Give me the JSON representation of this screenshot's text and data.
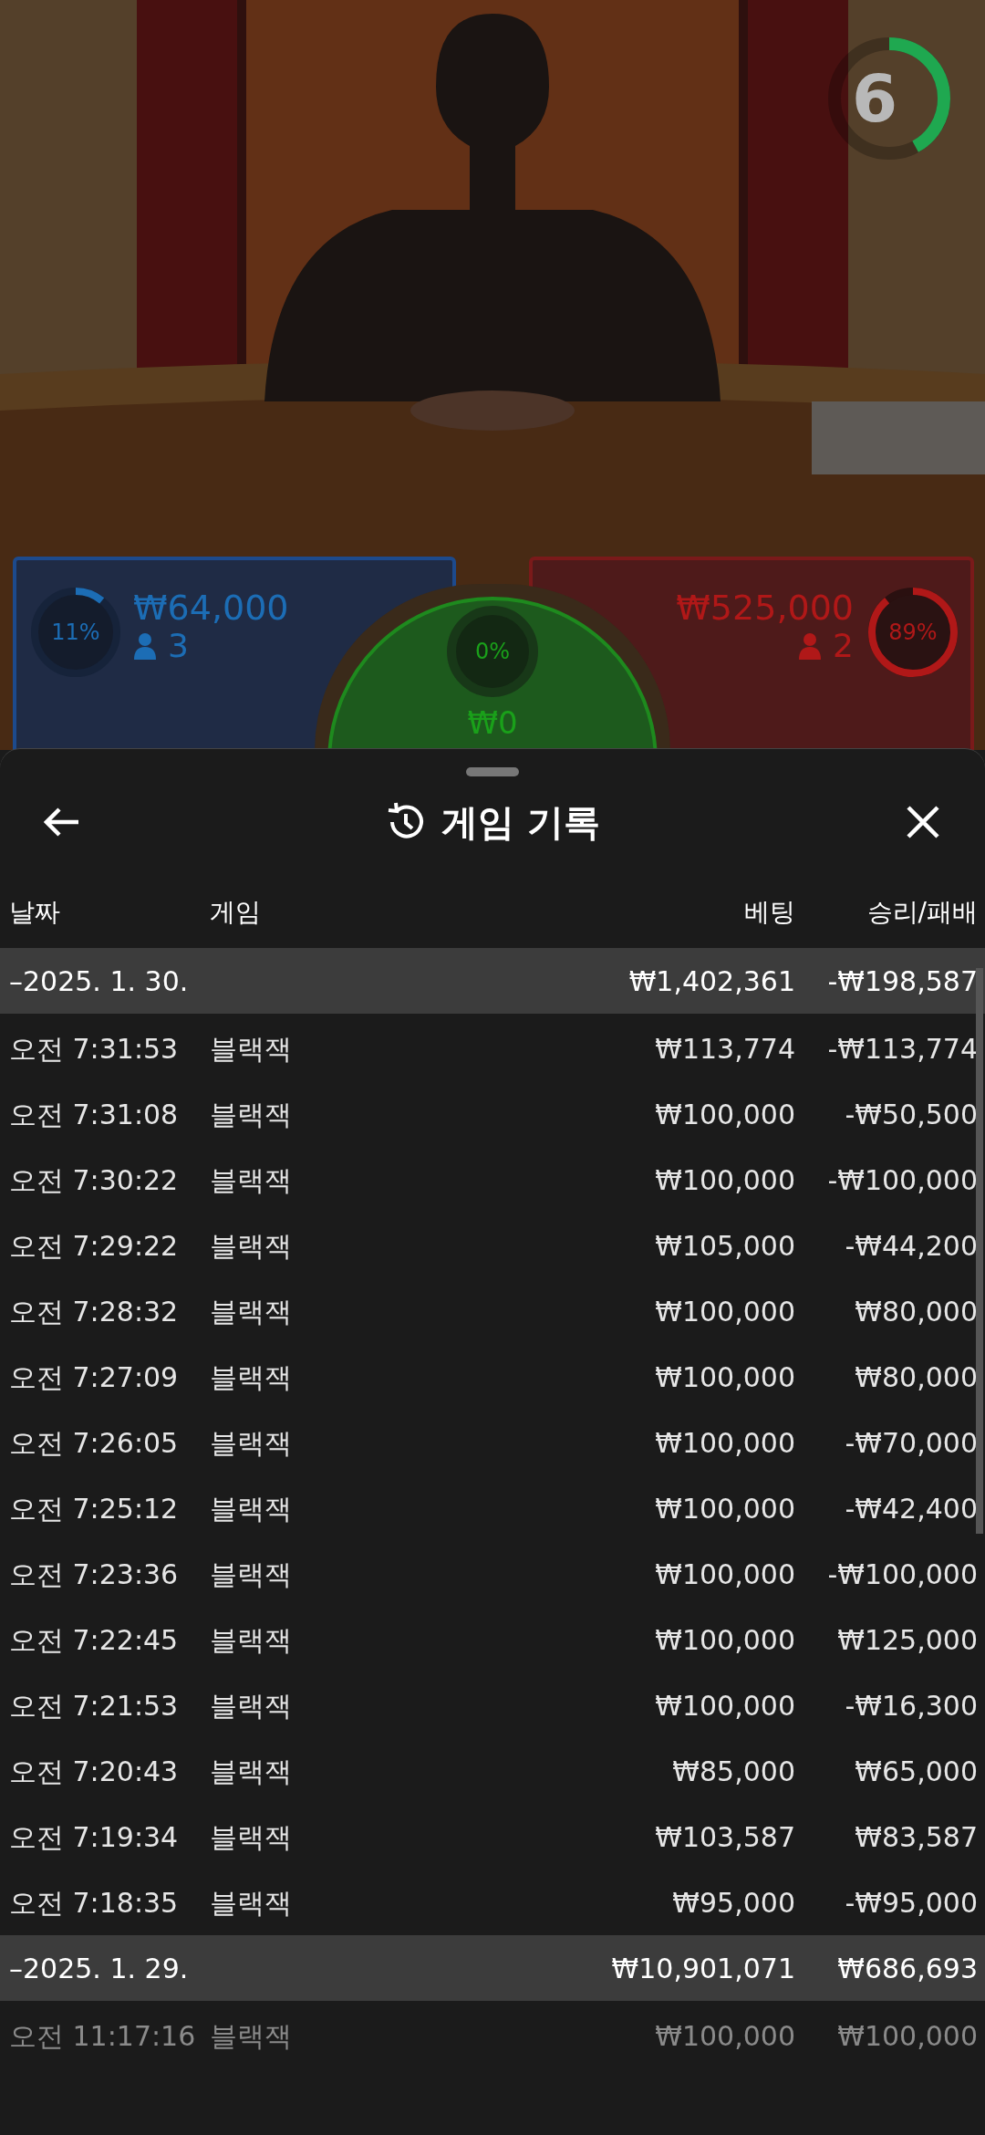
{
  "timer": {
    "count": "6",
    "level": 0.42
  },
  "bets": [
    {
      "kind": "player",
      "percent": "11%",
      "level": 0.11,
      "amount": "₩64,000",
      "players": "3"
    },
    {
      "kind": "tie",
      "percent": "0%",
      "level": 0,
      "amount": "₩0"
    },
    {
      "kind": "banker",
      "percent": "89%",
      "level": 0.89,
      "amount": "₩525,000",
      "players": "2"
    }
  ],
  "sheet": {
    "title": "게임 기록"
  },
  "table": {
    "columns": [
      "날짜",
      "게임",
      "베팅",
      "승리/패배"
    ],
    "rows": [
      {
        "kind": "group",
        "date": "–2025. 1. 30.",
        "bet": "₩1,402,361",
        "result": "-₩198,587"
      },
      {
        "kind": "game",
        "time": "오전 7:31:53",
        "game": "블랙잭",
        "bet": "₩113,774",
        "result": "-₩113,774",
        "dimmed": false
      },
      {
        "kind": "game",
        "time": "오전 7:31:08",
        "game": "블랙잭",
        "bet": "₩100,000",
        "result": "-₩50,500",
        "dimmed": false
      },
      {
        "kind": "game",
        "time": "오전 7:30:22",
        "game": "블랙잭",
        "bet": "₩100,000",
        "result": "-₩100,000",
        "dimmed": false
      },
      {
        "kind": "game",
        "time": "오전 7:29:22",
        "game": "블랙잭",
        "bet": "₩105,000",
        "result": "-₩44,200",
        "dimmed": false
      },
      {
        "kind": "game",
        "time": "오전 7:28:32",
        "game": "블랙잭",
        "bet": "₩100,000",
        "result": "₩80,000",
        "dimmed": false
      },
      {
        "kind": "game",
        "time": "오전 7:27:09",
        "game": "블랙잭",
        "bet": "₩100,000",
        "result": "₩80,000",
        "dimmed": false
      },
      {
        "kind": "game",
        "time": "오전 7:26:05",
        "game": "블랙잭",
        "bet": "₩100,000",
        "result": "-₩70,000",
        "dimmed": false
      },
      {
        "kind": "game",
        "time": "오전 7:25:12",
        "game": "블랙잭",
        "bet": "₩100,000",
        "result": "-₩42,400",
        "dimmed": false
      },
      {
        "kind": "game",
        "time": "오전 7:23:36",
        "game": "블랙잭",
        "bet": "₩100,000",
        "result": "-₩100,000",
        "dimmed": false
      },
      {
        "kind": "game",
        "time": "오전 7:22:45",
        "game": "블랙잭",
        "bet": "₩100,000",
        "result": "₩125,000",
        "dimmed": false
      },
      {
        "kind": "game",
        "time": "오전 7:21:53",
        "game": "블랙잭",
        "bet": "₩100,000",
        "result": "-₩16,300",
        "dimmed": false
      },
      {
        "kind": "game",
        "time": "오전 7:20:43",
        "game": "블랙잭",
        "bet": "₩85,000",
        "result": "₩65,000",
        "dimmed": false
      },
      {
        "kind": "game",
        "time": "오전 7:19:34",
        "game": "블랙잭",
        "bet": "₩103,587",
        "result": "₩83,587",
        "dimmed": false
      },
      {
        "kind": "game",
        "time": "오전 7:18:35",
        "game": "블랙잭",
        "bet": "₩95,000",
        "result": "-₩95,000",
        "dimmed": false
      },
      {
        "kind": "group",
        "date": "–2025. 1. 29.",
        "bet": "₩10,901,071",
        "result": "₩686,693"
      },
      {
        "kind": "game",
        "time": "오전 11:17:16",
        "game": "블랙잭",
        "bet": "₩100,000",
        "result": "₩100,000",
        "dimmed": true
      }
    ]
  }
}
